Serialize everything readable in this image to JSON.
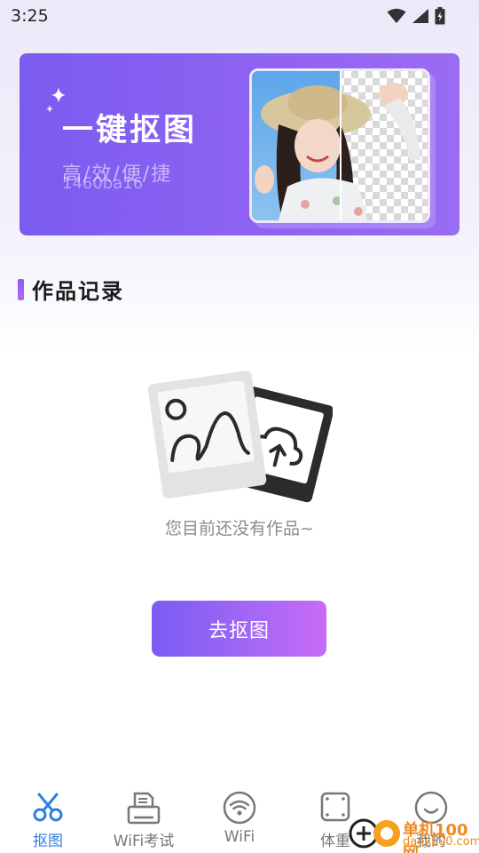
{
  "status_bar": {
    "time": "3:25",
    "icons": [
      "wifi-icon",
      "signal-icon",
      "battery-charging-icon"
    ]
  },
  "banner": {
    "title": "一键抠图",
    "subtitle": "高/效/便/捷",
    "watermark": "1460ba16",
    "image_alt": "before-after cutout preview"
  },
  "section": {
    "title": "作品记录"
  },
  "empty_state": {
    "message": "您目前还没有作品~",
    "button_label": "去抠图"
  },
  "tab_bar": {
    "tabs": [
      {
        "label": "抠图",
        "icon": "scissors-icon",
        "active": true
      },
      {
        "label": "WiFi考试",
        "icon": "printer-icon",
        "active": false
      },
      {
        "label": "WiFi",
        "icon": "wifi-icon",
        "active": false
      },
      {
        "label": "体重",
        "icon": "scale-icon",
        "active": false
      },
      {
        "label": "我的",
        "icon": "smile-icon",
        "active": false
      }
    ]
  },
  "site_watermark": {
    "cn": "单机100网",
    "en": "danji100.com"
  },
  "colors": {
    "accent": "#7b5cf3",
    "active_tab": "#2f7fe0",
    "banner": "#8a62f2"
  }
}
